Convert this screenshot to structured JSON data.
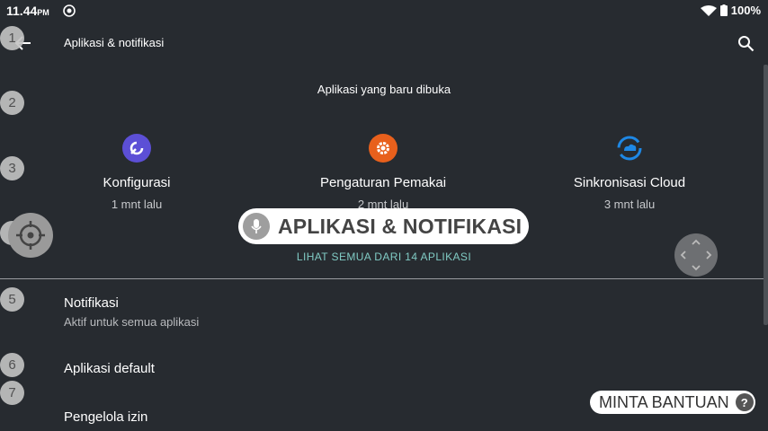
{
  "status_bar": {
    "time": "11.44",
    "ampm": "PM",
    "battery": "100%"
  },
  "top_bar": {
    "title": "Aplikasi & notifikasi",
    "back_icon": "arrow-left-icon",
    "search_icon": "search-icon"
  },
  "recent": {
    "heading": "Aplikasi yang baru dibuka",
    "apps": [
      {
        "name": "Konfigurasi",
        "time": "1 mnt lalu",
        "icon": "config-icon",
        "color": "#5c4fd6"
      },
      {
        "name": "Pengaturan Pemakai",
        "time": "2 mnt lalu",
        "icon": "gear-icon",
        "color": "#e8601c"
      },
      {
        "name": "Sinkronisasi Cloud",
        "time": "3 mnt lalu",
        "icon": "cloud-sync-icon",
        "color": "#1e88e5"
      }
    ],
    "see_all": "LIHAT SEMUA DARI 14 APLIKASI"
  },
  "list": [
    {
      "title": "Notifikasi",
      "subtitle": "Aktif untuk semua aplikasi"
    },
    {
      "title": "Aplikasi default",
      "subtitle": ""
    },
    {
      "title": "Pengelola izin",
      "subtitle": ""
    }
  ],
  "overlay": {
    "numbers": [
      "1",
      "2",
      "3",
      "4",
      "5",
      "6",
      "7"
    ],
    "voice_label": "APLIKASI & NOTIFIKASI",
    "help_label": "MINTA BANTUAN",
    "help_icon": "?"
  }
}
